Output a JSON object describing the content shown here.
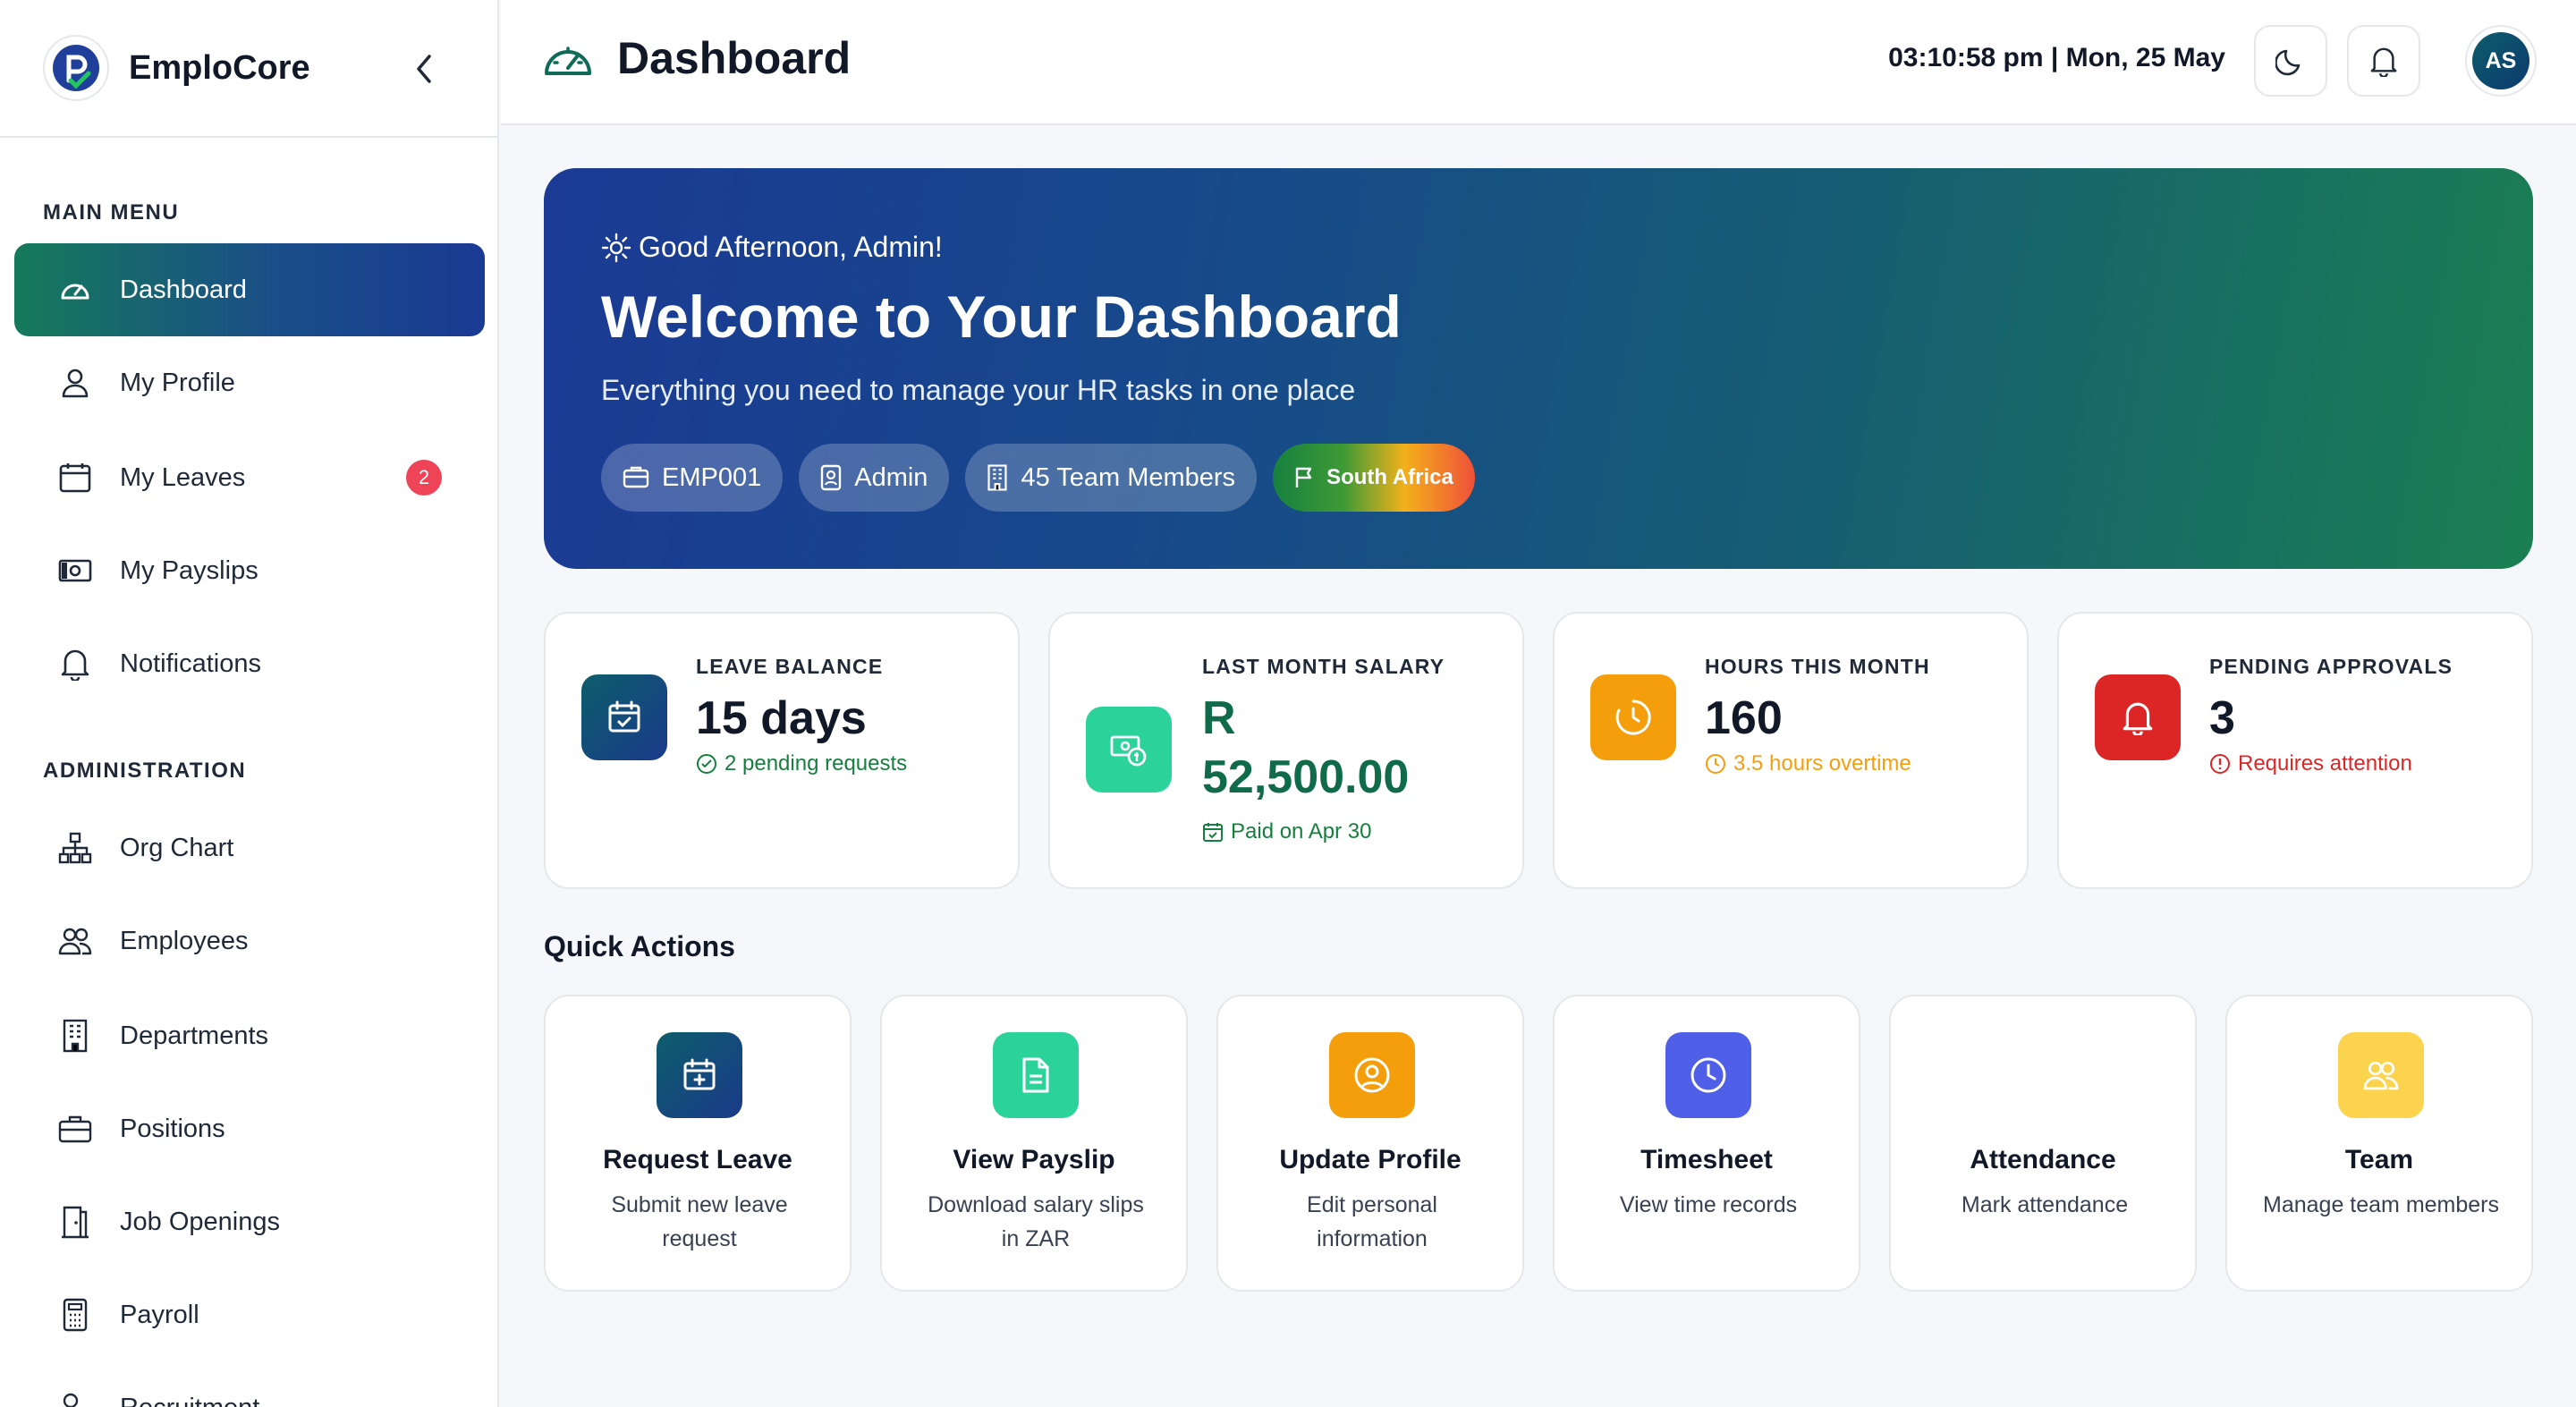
{
  "app": {
    "name": "EmploCore"
  },
  "sidebar": {
    "main_menu_title": "MAIN MENU",
    "admin_title": "ADMINISTRATION",
    "main_items": [
      {
        "label": "Dashboard",
        "icon": "gauge-icon",
        "active": true
      },
      {
        "label": "My Profile",
        "icon": "user-icon"
      },
      {
        "label": "My Leaves",
        "icon": "calendar-icon",
        "badge": "2"
      },
      {
        "label": "My Payslips",
        "icon": "banknote-icon"
      },
      {
        "label": "Notifications",
        "icon": "bell-icon"
      }
    ],
    "admin_items": [
      {
        "label": "Org Chart",
        "icon": "org-chart-icon"
      },
      {
        "label": "Employees",
        "icon": "users-icon"
      },
      {
        "label": "Departments",
        "icon": "building-icon"
      },
      {
        "label": "Positions",
        "icon": "briefcase-icon"
      },
      {
        "label": "Job Openings",
        "icon": "door-icon"
      },
      {
        "label": "Payroll",
        "icon": "calculator-icon"
      },
      {
        "label": "Recruitment",
        "icon": "user-plus-icon"
      }
    ]
  },
  "header": {
    "title": "Dashboard",
    "datetime": "03:10:58 pm | Mon, 25 May",
    "avatar_initials": "AS"
  },
  "hero": {
    "greeting": "Good Afternoon, Admin!",
    "title": "Welcome to Your Dashboard",
    "subtitle": "Everything you need to manage your HR tasks in one place",
    "pills": [
      {
        "label": "EMP001",
        "icon": "id-card-icon"
      },
      {
        "label": "Admin",
        "icon": "badge-icon"
      },
      {
        "label": "45 Team Members",
        "icon": "building-icon"
      },
      {
        "label": "South Africa",
        "icon": "flag-icon"
      }
    ]
  },
  "stats": [
    {
      "label": "LEAVE BALANCE",
      "value": "15 days",
      "note": "2 pending requests",
      "color": "#0d5d6b",
      "note_color": "#15803d"
    },
    {
      "label": "LAST MONTH SALARY",
      "value_line1": "R",
      "value_line2": "52,500.00",
      "note": "Paid on Apr 30",
      "color": "#2bd39b",
      "note_color": "#15803d"
    },
    {
      "label": "HOURS THIS MONTH",
      "value": "160",
      "note": "3.5 hours overtime",
      "color": "#f59e0b",
      "note_color": "#f59e0b"
    },
    {
      "label": "PENDING APPROVALS",
      "value": "3",
      "note": "Requires attention",
      "color": "#dc2626",
      "note_color": "#dc2626"
    }
  ],
  "quick_actions": {
    "title": "Quick Actions",
    "items": [
      {
        "title": "Request Leave",
        "desc": "Submit new leave request",
        "icon": "calendar-plus-icon",
        "color": "#0d5d6b"
      },
      {
        "title": "View Payslip",
        "desc": "Download salary slips in ZAR",
        "icon": "document-icon",
        "color": "#2bd39b"
      },
      {
        "title": "Update Profile",
        "desc": "Edit personal information",
        "icon": "user-circle-icon",
        "color": "#f59e0b"
      },
      {
        "title": "Timesheet",
        "desc": "View time records",
        "icon": "clock-icon",
        "color": "#4f5fe8"
      },
      {
        "title": "Attendance",
        "desc": "Mark attendance",
        "icon": "check-icon",
        "color": "#ffffff"
      },
      {
        "title": "Team",
        "desc": "Manage team members",
        "icon": "users-icon",
        "color": "#fcd34d"
      }
    ]
  }
}
